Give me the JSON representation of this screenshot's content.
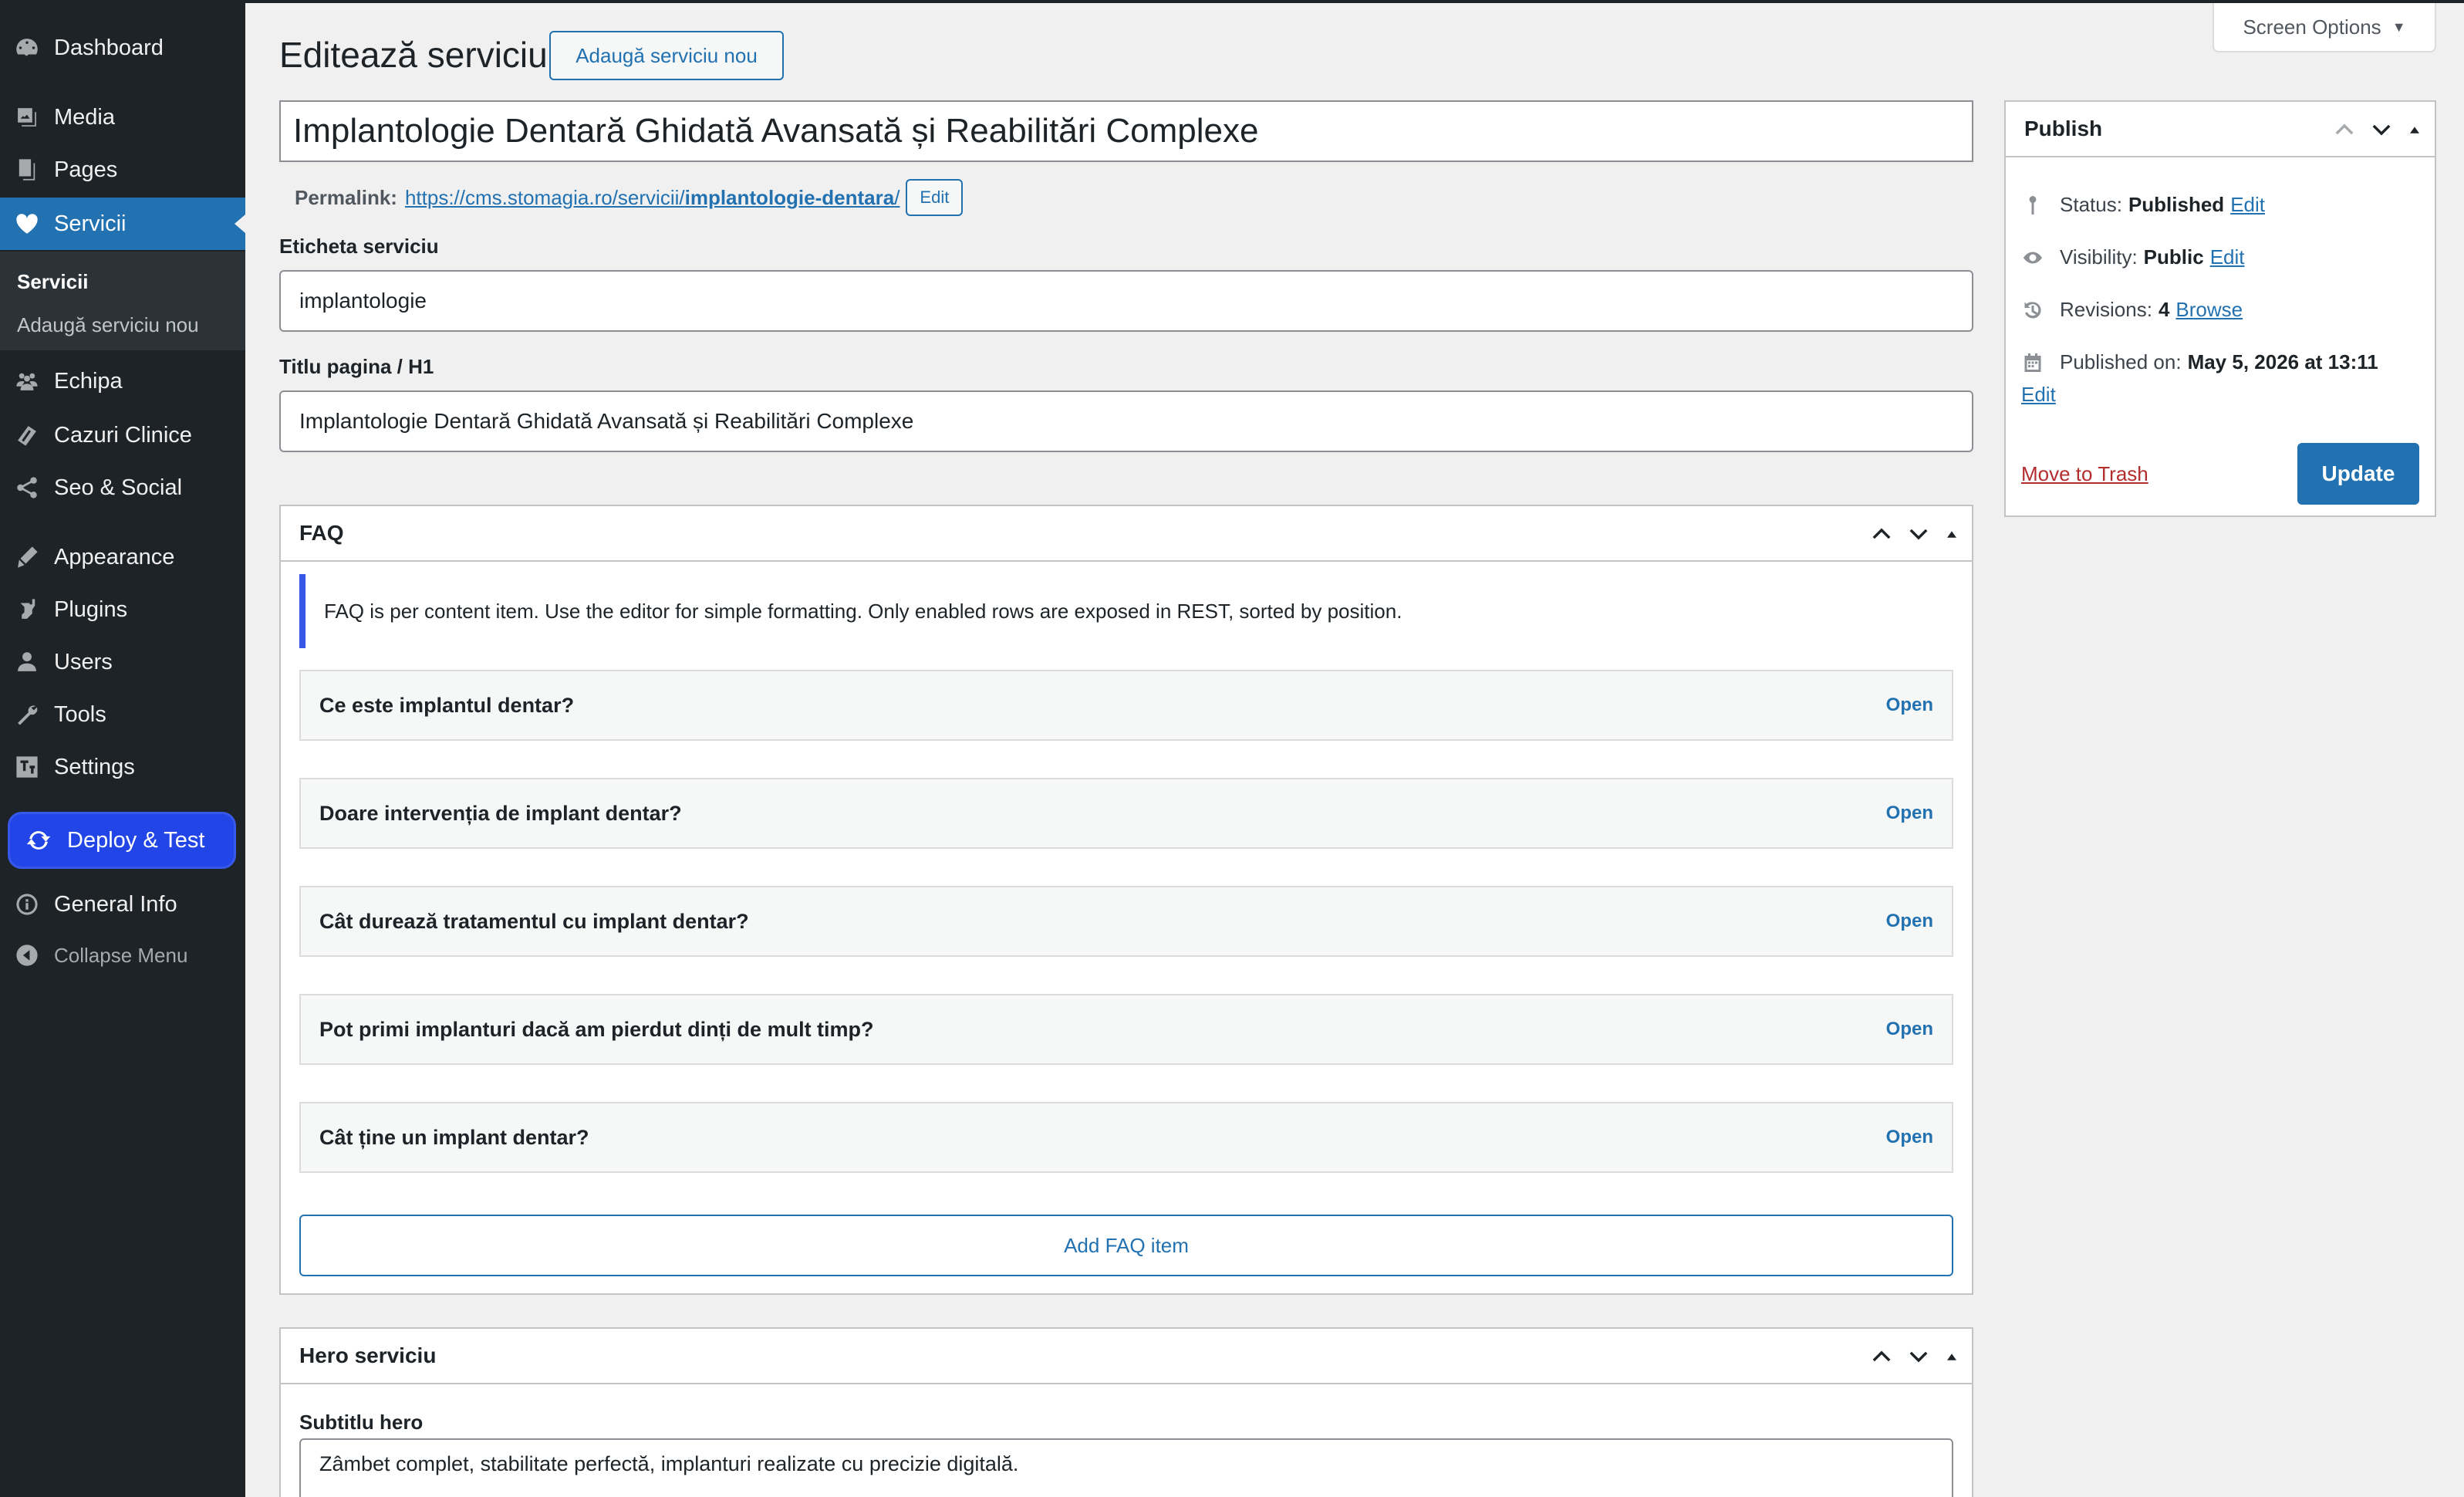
{
  "sidebar": {
    "items": [
      {
        "label": "Dashboard",
        "icon": "dashboard-icon"
      },
      {
        "label": "Media",
        "icon": "media-icon"
      },
      {
        "label": "Pages",
        "icon": "pages-icon"
      },
      {
        "label": "Servicii",
        "icon": "heart-icon"
      },
      {
        "label": "Echipa",
        "icon": "groups-icon"
      },
      {
        "label": "Cazuri Clinice",
        "icon": "cases-icon"
      },
      {
        "label": "Seo & Social",
        "icon": "share-icon"
      },
      {
        "label": "Appearance",
        "icon": "appearance-icon"
      },
      {
        "label": "Plugins",
        "icon": "plugins-icon"
      },
      {
        "label": "Users",
        "icon": "users-icon"
      },
      {
        "label": "Tools",
        "icon": "tools-icon"
      },
      {
        "label": "Settings",
        "icon": "settings-icon"
      }
    ],
    "submenu": [
      "Servicii",
      "Adaugă serviciu nou"
    ],
    "deploy": "Deploy & Test",
    "general_info": "General Info",
    "collapse": "Collapse Menu"
  },
  "header": {
    "title": "Editează serviciu",
    "add_new": "Adaugă serviciu nou",
    "screen_options": "Screen Options"
  },
  "post": {
    "title": "Implantologie Dentară Ghidată Avansată și Reabilitări Complexe",
    "permalink_label": "Permalink:",
    "permalink_base": "https://cms.stomagia.ro/servicii/",
    "permalink_slug": "implantologie-dentara",
    "permalink_end": "/",
    "permalink_edit": "Edit"
  },
  "fields": {
    "eticheta_label": "Eticheta serviciu",
    "eticheta_value": "implantologie",
    "titlu_label": "Titlu pagina / H1",
    "titlu_value": "Implantologie Dentară Ghidată Avansată și Reabilitări Complexe"
  },
  "faq": {
    "title": "FAQ",
    "note": "FAQ is per content item. Use the editor for simple formatting. Only enabled rows are exposed in REST, sorted by position.",
    "items": [
      {
        "question": "Ce este implantul dentar?",
        "action": "Open"
      },
      {
        "question": "Doare intervenția de implant dentar?",
        "action": "Open"
      },
      {
        "question": "Cât durează tratamentul cu implant dentar?",
        "action": "Open"
      },
      {
        "question": "Pot primi implanturi dacă am pierdut dinți de mult timp?",
        "action": "Open"
      },
      {
        "question": "Cât ține un implant dentar?",
        "action": "Open"
      }
    ],
    "add_label": "Add FAQ item"
  },
  "hero": {
    "title": "Hero serviciu",
    "subtitle_label": "Subtitlu hero",
    "subtitle_value": "Zâmbet complet, stabilitate perfectă, implanturi realizate cu precizie digitală."
  },
  "publish": {
    "title": "Publish",
    "status_label": "Status:",
    "status_value": "Published",
    "visibility_label": "Visibility:",
    "visibility_value": "Public",
    "revisions_label": "Revisions:",
    "revisions_value": "4",
    "browse": "Browse",
    "published_label": "Published on:",
    "published_value": "May 5, 2026 at 13:11",
    "edit": "Edit",
    "trash": "Move to Trash",
    "update": "Update"
  },
  "colors": {
    "sidebar_bg": "#1d2327",
    "accent": "#2271b1",
    "deploy_accent": "#3858e9",
    "trash": "#b32d2e"
  }
}
